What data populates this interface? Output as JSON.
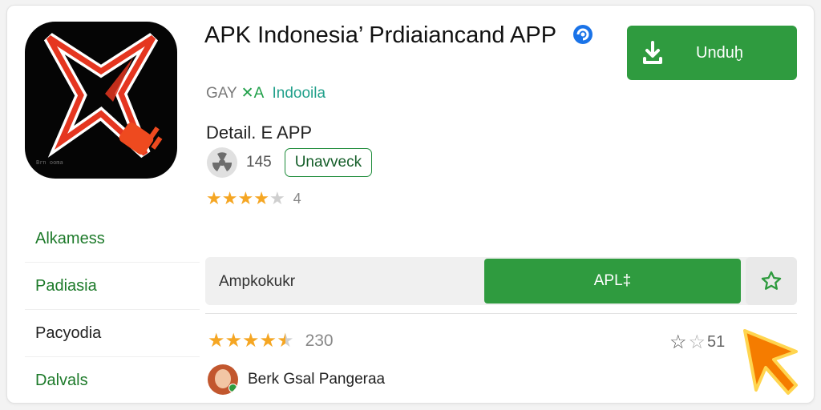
{
  "app": {
    "title": "APK Indonesia’ Prdiaiancand APP",
    "developer_prefix": "GAY",
    "developer_mark": "✕A",
    "developer_link": "Indooila",
    "detail": "Detail. E APP",
    "icon_caption": "Brn ooma",
    "count": "145",
    "chip_label": "Unavveck",
    "rating_value": "4",
    "rating_stars": 4
  },
  "download_button": {
    "label": "Unduḫ",
    "icon": "download-icon"
  },
  "nav": {
    "items": [
      {
        "label": "Alkamess"
      },
      {
        "label": "Padiasia"
      },
      {
        "label": "Pacyodia"
      },
      {
        "label": "Dalvals"
      }
    ]
  },
  "search": {
    "text": "Ampkokukr",
    "button_label": "APL‡",
    "fav_icon": "star-outline-icon"
  },
  "review": {
    "rating_stars": 4.5,
    "count": "230",
    "reviewer_name": "Berk Gsal Pangeraa",
    "right_value": "51"
  },
  "colors": {
    "accent_green": "#2f9b3f",
    "star": "#f5a623",
    "cursor": "#f57c00"
  }
}
